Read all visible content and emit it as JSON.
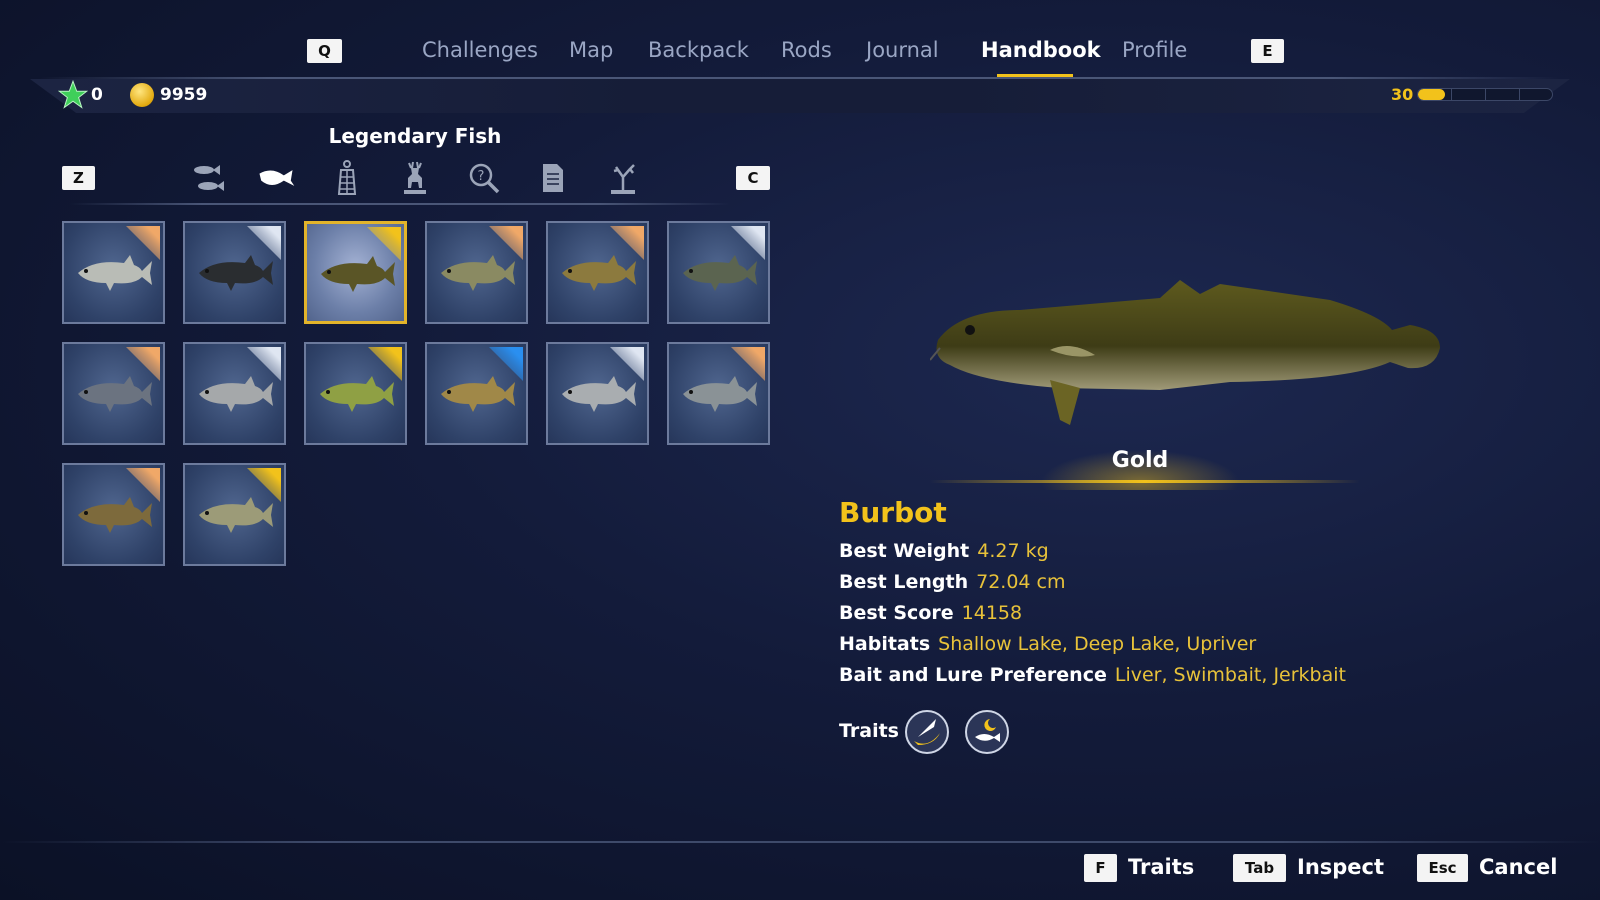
{
  "nav": {
    "prev_key": "Q",
    "next_key": "E",
    "tabs": [
      {
        "label": "Challenges"
      },
      {
        "label": "Map"
      },
      {
        "label": "Backpack"
      },
      {
        "label": "Rods"
      },
      {
        "label": "Journal"
      },
      {
        "label": "Handbook",
        "active": true
      },
      {
        "label": "Profile"
      }
    ]
  },
  "status": {
    "stars": "0",
    "coins": "9959",
    "level": "30",
    "level_progress": 0.2,
    "accent": "#f2c21b"
  },
  "category": {
    "title": "Legendary Fish",
    "prev_key": "Z",
    "next_key": "C",
    "icons": [
      {
        "name": "fish-school-icon"
      },
      {
        "name": "legendary-fish-icon",
        "active": true
      },
      {
        "name": "keepnet-icon"
      },
      {
        "name": "deer-trophy-icon"
      },
      {
        "name": "magnifier-question-icon"
      },
      {
        "name": "document-icon"
      },
      {
        "name": "dead-tree-icon"
      }
    ]
  },
  "fish_grid": [
    {
      "tier": "bronze",
      "color": "#b9bcb6"
    },
    {
      "tier": "silver",
      "color": "#2a2d30"
    },
    {
      "tier": "gold",
      "color": "#5a5526",
      "selected": true
    },
    {
      "tier": "bronze",
      "color": "#8a8a62"
    },
    {
      "tier": "bronze",
      "color": "#8c7a3e"
    },
    {
      "tier": "silver",
      "color": "#5b6450"
    },
    {
      "tier": "bronze",
      "color": "#6b7380"
    },
    {
      "tier": "silver",
      "color": "#a5a8aa"
    },
    {
      "tier": "gold",
      "color": "#8fa044"
    },
    {
      "tier": "diamond",
      "color": "#a08848"
    },
    {
      "tier": "silver",
      "color": "#a9adb0"
    },
    {
      "tier": "bronze",
      "color": "#8a9296"
    },
    {
      "tier": "bronze",
      "color": "#7d6a3c"
    },
    {
      "tier": "gold",
      "color": "#9c9b78"
    }
  ],
  "tier_colors": {
    "bronze": "#f0a868",
    "silver": "#dfe6f2",
    "gold": "#f2c21b",
    "diamond": "#2a8ff0"
  },
  "detail": {
    "rank": "Gold",
    "name": "Burbot",
    "rows": [
      {
        "label": "Best Weight",
        "value": "4.27 kg"
      },
      {
        "label": "Best Length",
        "value": "72.04 cm"
      },
      {
        "label": "Best Score",
        "value": "14158"
      },
      {
        "label": "Habitats",
        "value": "Shallow Lake, Deep Lake, Upriver"
      },
      {
        "label": "Bait and Lure Preference",
        "value": "Liver, Swimbait, Jerkbait"
      }
    ],
    "traits_label": "Traits",
    "traits": [
      {
        "name": "fish-bite-day-icon"
      },
      {
        "name": "fish-night-moon-icon"
      }
    ]
  },
  "footer": [
    {
      "key": "F",
      "label": "Traits"
    },
    {
      "key": "Tab",
      "label": "Inspect"
    },
    {
      "key": "Esc",
      "label": "Cancel"
    }
  ]
}
